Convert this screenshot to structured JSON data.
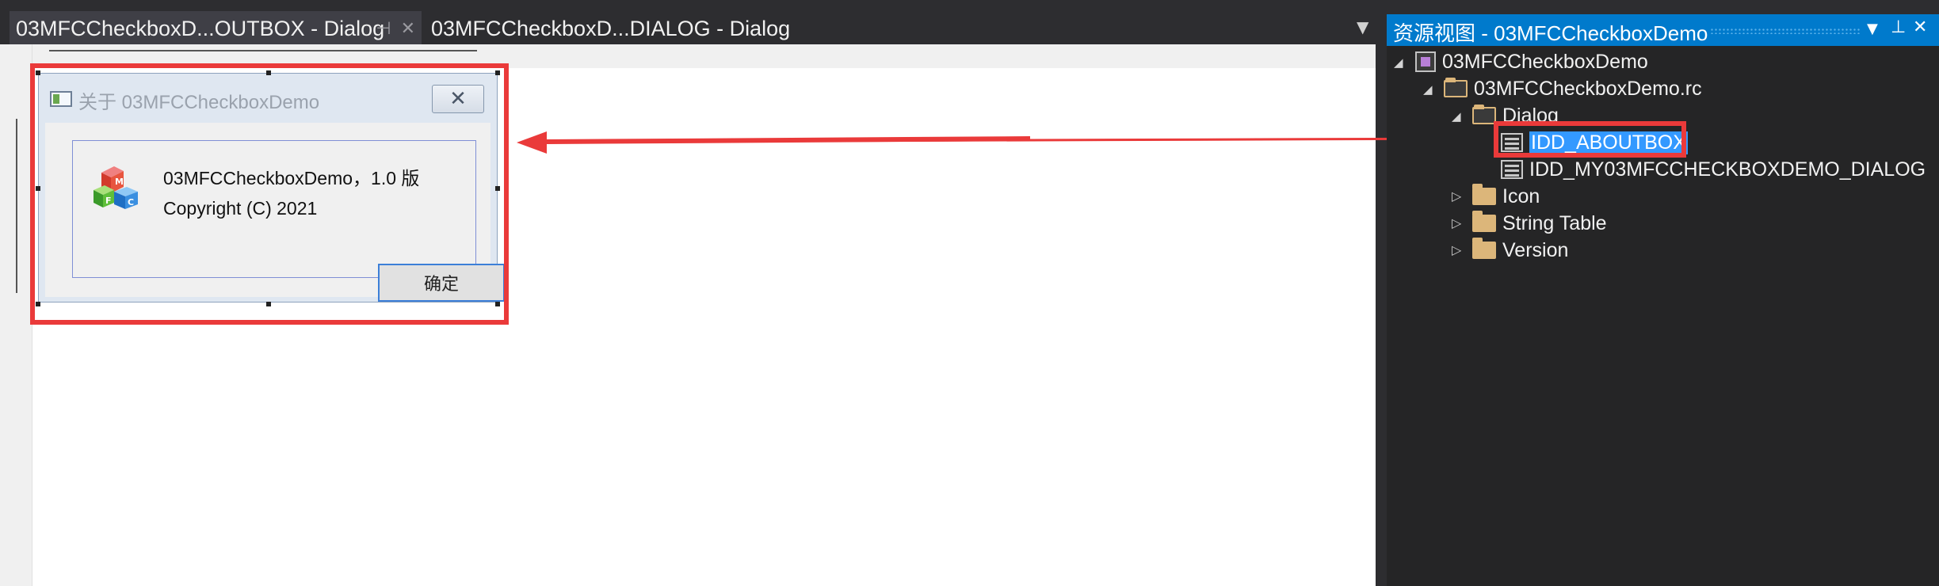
{
  "editor": {
    "tabs": [
      {
        "label": "03MFCCheckboxD...OUTBOX - Dialog",
        "pin_icon": "pin-icon",
        "close_icon": "close-icon"
      },
      {
        "label": "03MFCCheckboxD...DIALOG - Dialog"
      }
    ],
    "dropdown_icon": "▼"
  },
  "dialog": {
    "title": "关于 03MFCCheckboxDemo",
    "close_glyph": "✕",
    "line1": "03MFCCheckboxDemo，1.0 版",
    "line2": "Copyright (C) 2021",
    "ok_label": "确定"
  },
  "resource_view": {
    "title": "资源视图 - 03MFCCheckboxDemo",
    "menu_glyph": "▼",
    "pin_glyph": "📌",
    "close_glyph": "✕",
    "tree": {
      "project": "03MFCCheckboxDemo",
      "rc_file": "03MFCCheckboxDemo.rc",
      "dialog_folder": "Dialog",
      "dialogs": [
        "IDD_ABOUTBOX",
        "IDD_MY03MFCCHECKBOXDEMO_DIALOG"
      ],
      "folders": [
        "Icon",
        "String Table",
        "Version"
      ],
      "selected": "IDD_ABOUTBOX"
    }
  },
  "colors": {
    "annotation": "#ea3a3a",
    "selection": "#3399ff",
    "panel_header": "#007acc"
  }
}
